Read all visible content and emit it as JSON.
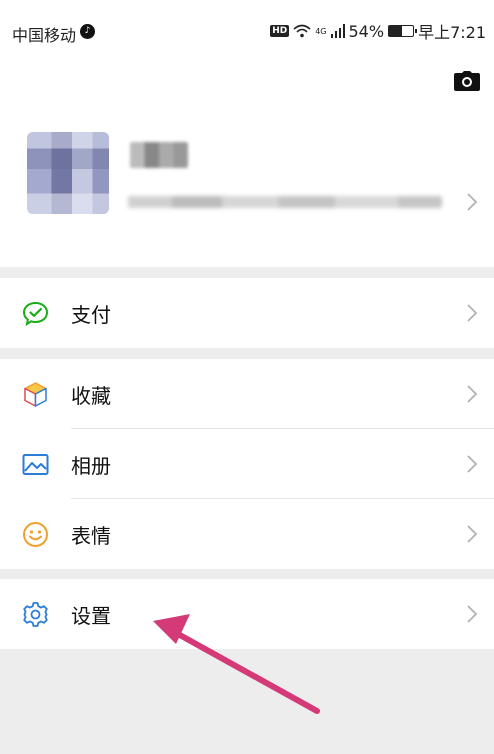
{
  "status_bar": {
    "carrier": "中国移动",
    "hd_badge": "HD",
    "network": "4G",
    "battery": "54%",
    "battery_level": 0.54,
    "time": "早上7:21"
  },
  "profile": {
    "nickname": "",
    "wechat_id": ""
  },
  "menu": {
    "pay": "支付",
    "favorites": "收藏",
    "album": "相册",
    "stickers": "表情",
    "settings": "设置"
  },
  "icons": {
    "camera": "camera-icon",
    "pay": "wechat-pay-icon",
    "favorites": "cube-icon",
    "album": "image-icon",
    "stickers": "smiley-icon",
    "settings": "gear-icon",
    "chevron": "chevron-right-icon",
    "annotation": "arrow-icon"
  },
  "colors": {
    "pay_icon": "#1aad19",
    "album_icon": "#2b7dd8",
    "stickers_icon": "#f0a030",
    "settings_icon": "#2b7dd8",
    "annotation_arrow": "#d43a78"
  }
}
